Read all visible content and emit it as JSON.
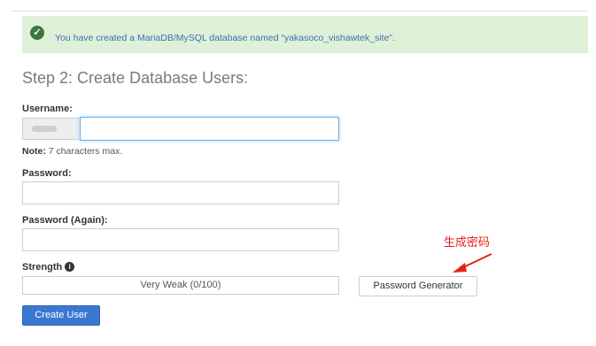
{
  "alert": {
    "icon": "check-circle-icon",
    "message": "You have created a MariaDB/MySQL database named “yakasoco_vishawtek_site”."
  },
  "step": {
    "title": "Step 2: Create Database Users:"
  },
  "username": {
    "label": "Username:",
    "value": "",
    "note_bold": "Note:",
    "note_text": " 7 characters max."
  },
  "password": {
    "label": "Password:",
    "value": ""
  },
  "password_again": {
    "label": "Password (Again):",
    "value": ""
  },
  "strength": {
    "label": "Strength",
    "info_icon": "info-circle-icon",
    "meter_text": "Very Weak (0/100)",
    "score": 0
  },
  "buttons": {
    "generator": "Password Generator",
    "create_user": "Create User"
  },
  "annotation": {
    "text": "生成密码",
    "color": "#e2231a"
  },
  "colors": {
    "alert_bg": "#dff0d8",
    "primary": "#3a78d0"
  }
}
